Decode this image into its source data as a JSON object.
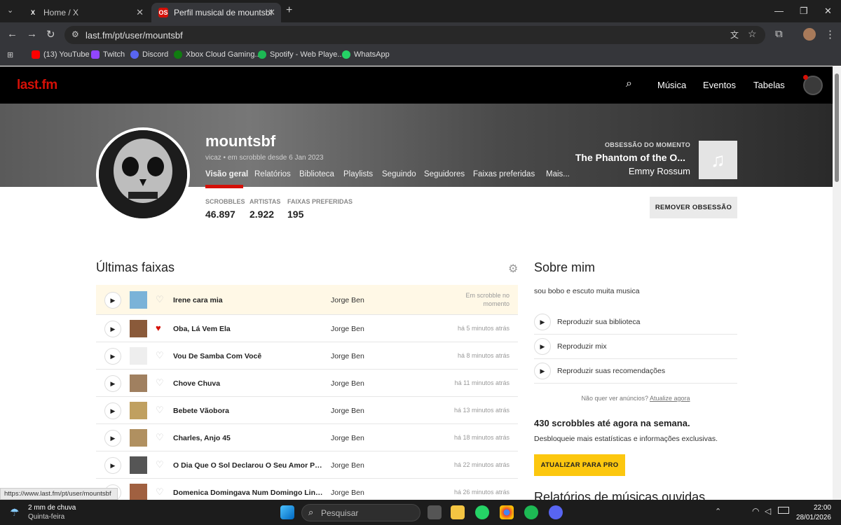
{
  "browser": {
    "tabs": [
      {
        "title": "Home / X",
        "favicon": "X"
      },
      {
        "title": "Perfil musical de mountsbf | Las",
        "favicon": "OS"
      }
    ],
    "url": "last.fm/pt/user/mountsbf",
    "bookmarks": [
      "(13) YouTube",
      "Twitch",
      "Discord",
      "Xbox Cloud Gaming...",
      "Spotify - Web Playe...",
      "WhatsApp"
    ],
    "status_url": "https://www.last.fm/pt/user/mountsbf"
  },
  "site": {
    "logo": "last.fm",
    "nav": [
      "Música",
      "Eventos",
      "Tabelas"
    ]
  },
  "profile": {
    "username": "mountsbf",
    "meta": "vicaz • em scrobble desde 6 Jan 2023",
    "tabs": [
      "Visão geral",
      "Relatórios",
      "Biblioteca",
      "Playlists",
      "Seguindo",
      "Seguidores",
      "Faixas preferidas",
      "Mais..."
    ],
    "obsession": {
      "label": "OBSESSÃO DO MOMENTO",
      "track": "The Phantom of the O...",
      "artist": "Emmy Rossum"
    },
    "stats": [
      {
        "label": "SCROBBLES",
        "value": "46.897"
      },
      {
        "label": "ARTISTAS",
        "value": "2.922"
      },
      {
        "label": "FAIXAS PREFERIDAS",
        "value": "195"
      }
    ],
    "remove_obsession": "REMOVER OBSESSÃO"
  },
  "recent": {
    "title": "Últimas faixas",
    "tracks": [
      {
        "name": "Irene cara mia",
        "artist": "Jorge Ben",
        "time": "Em scrobble no momento",
        "loved": false,
        "now": true
      },
      {
        "name": "Oba, Lá Vem Ela",
        "artist": "Jorge Ben",
        "time": "há 5 minutos atrás",
        "loved": true
      },
      {
        "name": "Vou De Samba Com Você",
        "artist": "Jorge Ben",
        "time": "há 8 minutos atrás",
        "loved": false
      },
      {
        "name": "Chove Chuva",
        "artist": "Jorge Ben",
        "time": "há 11 minutos atrás",
        "loved": false
      },
      {
        "name": "Bebete Vãobora",
        "artist": "Jorge Ben",
        "time": "há 13 minutos atrás",
        "loved": false
      },
      {
        "name": "Charles, Anjo 45",
        "artist": "Jorge Ben",
        "time": "há 18 minutos atrás",
        "loved": false
      },
      {
        "name": "O Dia Que O Sol Declarou O Seu Amor Pela Terra",
        "artist": "Jorge Ben",
        "time": "há 22 minutos atrás",
        "loved": false
      },
      {
        "name": "Domenica Domingava Num Domingo Linda...",
        "artist": "Jorge Ben",
        "time": "há 26 minutos atrás",
        "loved": false
      }
    ]
  },
  "about": {
    "title": "Sobre mim",
    "text": "sou bobo e escuto muita musica",
    "play_options": [
      "Reproduzir sua biblioteca",
      "Reproduzir mix",
      "Reproduzir suas recomendações"
    ],
    "ads_text": "Não quer ver anúncios?",
    "ads_link": "Atualize agora",
    "weekly": "430 scrobbles até agora na semana.",
    "weekly_sub": "Desbloqueie mais estatísticas e informações exclusivas.",
    "pro_button": "ATUALIZAR PARA PRO",
    "reports_title": "Relatórios de músicas ouvidas"
  },
  "taskbar": {
    "weather": "2 mm de chuva",
    "weather_day": "Quinta-feira",
    "search_placeholder": "Pesquisar",
    "time": "22:00",
    "date": "28/01/2026"
  },
  "colors": {
    "brand": "#d51007",
    "pro": "#fcc70f"
  }
}
